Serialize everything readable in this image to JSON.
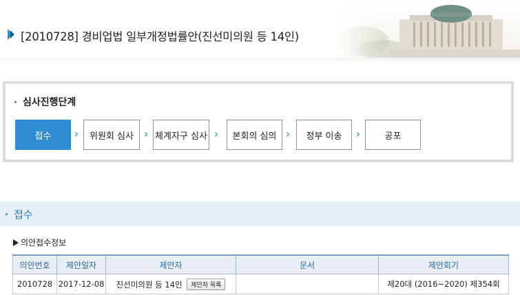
{
  "header": {
    "bill_title": "[2010728] 경비업법 일부개정법률안(진선미의원 등 14인)"
  },
  "process": {
    "heading": "심사진행단계",
    "steps": [
      {
        "label": "접수",
        "active": true
      },
      {
        "label": "위원회 심사",
        "active": false
      },
      {
        "label": "체계자구 심사",
        "active": false
      },
      {
        "label": "본회의 심의",
        "active": false
      },
      {
        "label": "정부 이송",
        "active": false
      },
      {
        "label": "공포",
        "active": false
      }
    ]
  },
  "section": {
    "title": "접수"
  },
  "receipt": {
    "subheading": "의안접수정보",
    "columns": [
      "의안번호",
      "제안일자",
      "제안자",
      "문서",
      "제안회기"
    ],
    "rows": [
      {
        "bill_no": "2010728",
        "date": "2017-12-08",
        "proposer": "진선미의원 등 14인",
        "proposer_btn": "제안자 목록",
        "document": "",
        "session": "제20대 (2016~2020) 제354회"
      }
    ]
  },
  "colors": {
    "accent": "#2f8ed1",
    "section_bg": "#e6eff6",
    "table_header_bg": "#e8eef4"
  }
}
